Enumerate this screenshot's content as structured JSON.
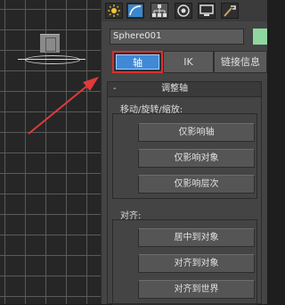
{
  "command_panel": {
    "tabs": [
      {
        "icon": "sun-icon"
      },
      {
        "icon": "curve-icon"
      },
      {
        "icon": "hierarchy-icon"
      },
      {
        "icon": "motion-icon"
      },
      {
        "icon": "display-icon"
      },
      {
        "icon": "hammer-icon"
      }
    ],
    "object_name": "Sphere001",
    "object_color": "#8fd7a0"
  },
  "hierarchy_tabs": {
    "pivot": "轴",
    "ik": "IK",
    "link_info": "链接信息"
  },
  "rollout": {
    "collapse_symbol": "-",
    "title": "调整轴",
    "move_group": {
      "label": "移动/旋转/缩放:",
      "buttons": [
        "仅影响轴",
        "仅影响对象",
        "仅影响层次"
      ]
    },
    "align_group": {
      "label": "对齐:",
      "buttons": [
        "居中到对象",
        "对齐到对象",
        "对齐到世界"
      ]
    }
  },
  "colors": {
    "accent_highlight": "#d93030",
    "active_button": "#3f89d6"
  }
}
